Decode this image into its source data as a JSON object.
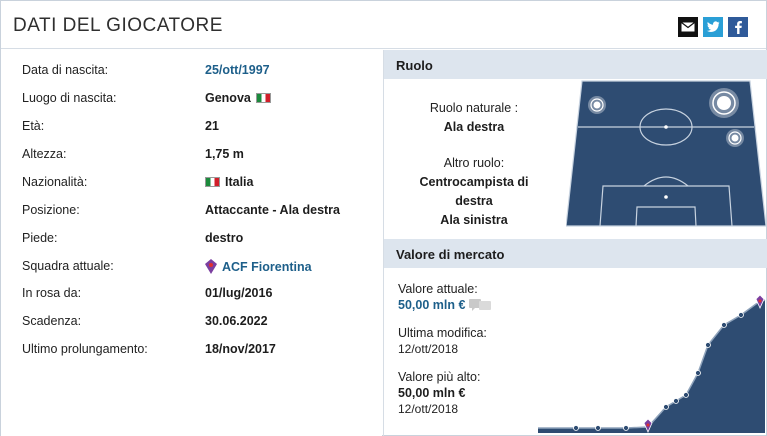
{
  "header": {
    "title": "DATI DEL GIOCATORE",
    "share": [
      {
        "name": "email-share-button",
        "icon": "envelope-icon",
        "color": "#111111"
      },
      {
        "name": "twitter-share-button",
        "icon": "twitter-bird-icon",
        "color": "#2a9fd6"
      },
      {
        "name": "facebook-share-button",
        "icon": "facebook-f-icon",
        "color": "#2f5a99"
      }
    ]
  },
  "player": {
    "rows": [
      {
        "label": "Data di nascita:",
        "value": "25/ott/1997",
        "link": true
      },
      {
        "label": "Luogo di nascita:",
        "value": "Genova",
        "flag": "italy-flag-icon"
      },
      {
        "label": "Età:",
        "value": "21"
      },
      {
        "label": "Altezza:",
        "value": "1,75 m"
      },
      {
        "label": "Nazionalità:",
        "value": "Italia",
        "flag": "italy-flag-icon"
      },
      {
        "label": "Posizione:",
        "value": "Attaccante - Ala destra"
      },
      {
        "label": "Piede:",
        "value": "destro"
      },
      {
        "label": "Squadra attuale:",
        "value": "ACF Fiorentina",
        "link": true,
        "icon": "fiorentina-crest-icon"
      },
      {
        "label": "In rosa da:",
        "value": "01/lug/2016"
      },
      {
        "label": "Scadenza:",
        "value": "30.06.2022"
      },
      {
        "label": "Ultimo prolungamento:",
        "value": "18/nov/2017"
      }
    ]
  },
  "role": {
    "heading": "Ruolo",
    "natural_label": "Ruolo naturale :",
    "natural_value": "Ala destra",
    "other_label": "Altro ruolo:",
    "other_values": [
      "Centrocampista di",
      "destra",
      "Ala sinistra"
    ],
    "pitch_color": "#2e4c72"
  },
  "market": {
    "heading": "Valore di mercato",
    "current_label": "Valore attuale:",
    "current_value": "50,00 mln €",
    "last_change_label": "Ultima modifica:",
    "last_change_date": "12/ott/2018",
    "highest_label": "Valore più alto:",
    "highest_value": "50,00 mln €",
    "highest_date": "12/ott/2018",
    "chart_color": "#2e4c72"
  },
  "colors": {
    "accent_link": "#1d5f8a",
    "section_header_bg": "#dde5ee"
  }
}
